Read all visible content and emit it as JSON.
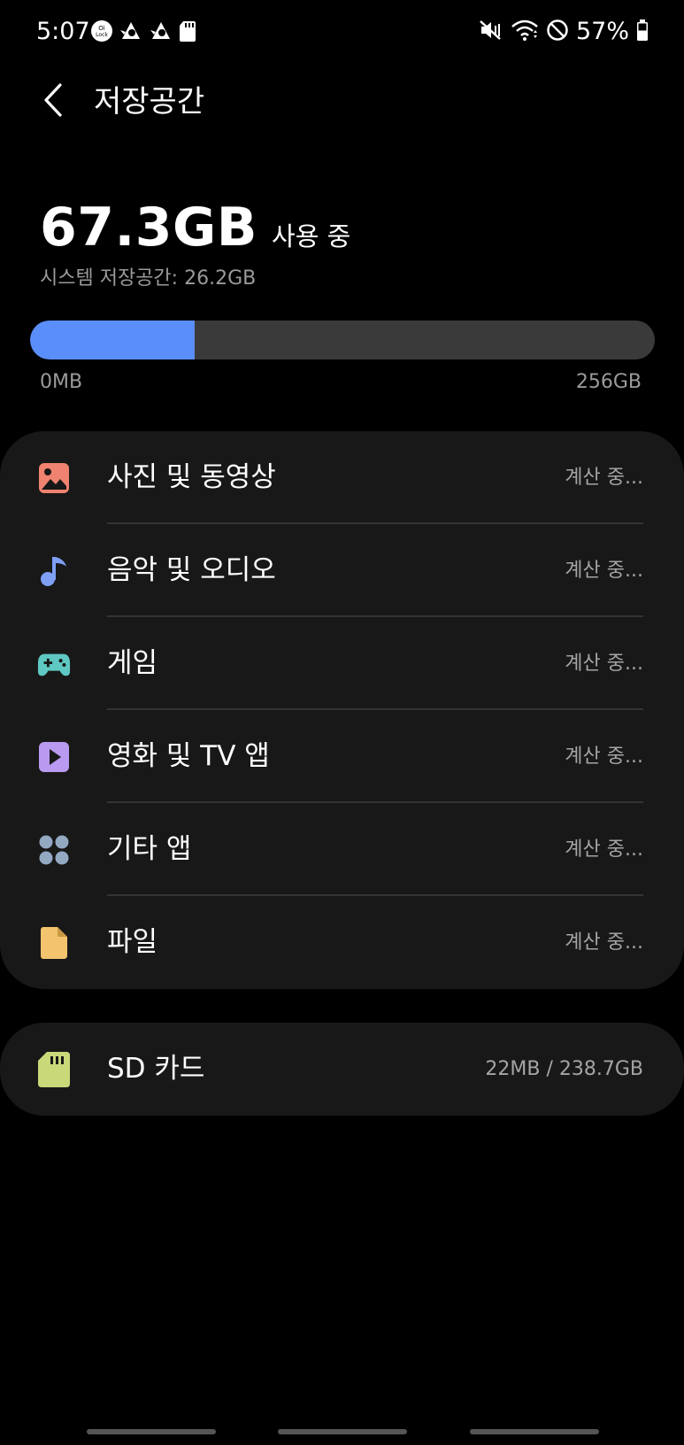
{
  "status_bar": {
    "time": "5:07",
    "battery": "57%",
    "left_icons": [
      "oi-lock-app-icon",
      "avast-icon",
      "avast-icon",
      "sd-card-icon"
    ],
    "right_icons": [
      "mute-vibrate-icon",
      "wifi-icon",
      "do-not-disturb-icon",
      "battery-icon"
    ]
  },
  "header": {
    "title": "저장공간"
  },
  "usage": {
    "amount": "67.3GB",
    "suffix": "사용 중",
    "system_storage": "시스템 저장공간: 26.2GB",
    "bar_min_label": "0MB",
    "bar_max_label": "256GB",
    "used_fraction": 0.263,
    "bar_color": "#5a8ffb"
  },
  "categories": [
    {
      "label": "사진 및 동영상",
      "value": "계산 중...",
      "icon": "image-icon",
      "color": "#f0836f"
    },
    {
      "label": "음악 및 오디오",
      "value": "계산 중...",
      "icon": "music-note-icon",
      "color": "#7f9ff5"
    },
    {
      "label": "게임",
      "value": "계산 중...",
      "icon": "gamepad-icon",
      "color": "#5fc8c2"
    },
    {
      "label": "영화 및 TV 앱",
      "value": "계산 중...",
      "icon": "play-icon",
      "color": "#b99af0"
    },
    {
      "label": "기타 앱",
      "value": "계산 중...",
      "icon": "apps-grid-icon",
      "color": "#93a9c2"
    },
    {
      "label": "파일",
      "value": "계산 중...",
      "icon": "file-icon",
      "color": "#f3c36d"
    }
  ],
  "sd_card": {
    "label": "SD 카드",
    "value": "22MB / 238.7GB",
    "icon": "sd-card-icon",
    "color": "#c9d97a"
  }
}
